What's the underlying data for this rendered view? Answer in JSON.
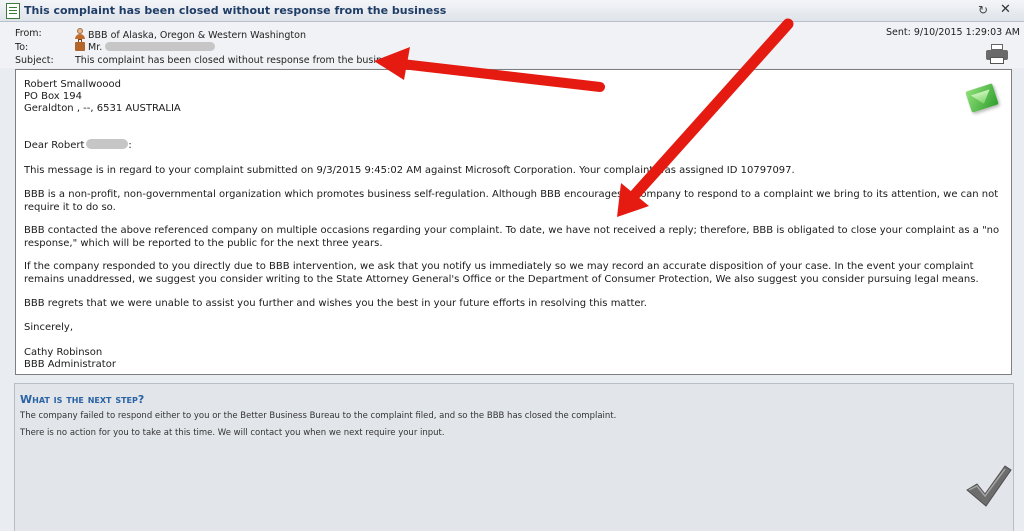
{
  "window": {
    "title": "This complaint has been closed without response from the business"
  },
  "header": {
    "from_label": "From:",
    "from_value": "BBB of Alaska, Oregon & Western Washington",
    "to_label": "To:",
    "to_value": "Mr.",
    "subject_label": "Subject:",
    "subject_value": "This complaint has been closed without response from the business",
    "sent": "Sent: 9/10/2015 1:29:03 AM"
  },
  "letter": {
    "address_line1": "Robert Smallwoood",
    "address_line2": "PO Box 194",
    "address_line3": "Geraldton , --, 6531 AUSTRALIA",
    "greeting": "Dear Robert",
    "greeting_suffix": ":",
    "para1": "This message is in regard to your complaint submitted on 9/3/2015 9:45:02 AM against Microsoft Corporation.  Your complaint was assigned ID 10797097.",
    "para2": "BBB is a non-profit, non-governmental organization which promotes business self-regulation.  Although BBB encourages a company to respond to a complaint we bring to its attention, we can not require it to do so.",
    "para3": "BBB contacted the above referenced company on multiple occasions regarding your complaint.  To date, we have not received a reply; therefore, BBB is obligated to close your complaint as a \"no response,\" which will be reported to the public for the next three years.",
    "para4": "If the company responded to you directly due to BBB intervention, we ask that you notify us immediately so we may record an accurate disposition of your case.  In the event your complaint remains unaddressed, we suggest you consider writing to the State Attorney General's Office or the Department of Consumer Protection,  We also suggest you consider pursuing legal means.",
    "para5": "BBB regrets that we were unable to assist you further and wishes you the best in your future efforts in resolving this matter.",
    "closing": "Sincerely,",
    "sig_name": "Cathy Robinson",
    "sig_title": "BBB Administrator"
  },
  "next_step": {
    "heading": "What is the next step?",
    "text1": "The company failed to respond either to you or the Better Business Bureau to the complaint filed, and so the BBB has closed the complaint.",
    "text2": "There is no action for you to take at this time. We will contact you when we next require your input."
  },
  "icons": {
    "window": "document-icon",
    "from": "person-icon",
    "to": "briefcase-icon",
    "print": "printer-icon",
    "message": "envelope-icon",
    "done": "checkmark-icon"
  },
  "colors": {
    "title_text": "#1f3d66",
    "heading_blue": "#2a63a5",
    "annotation_arrow": "#e51b12",
    "envelope_green": "#2f9e2c"
  }
}
